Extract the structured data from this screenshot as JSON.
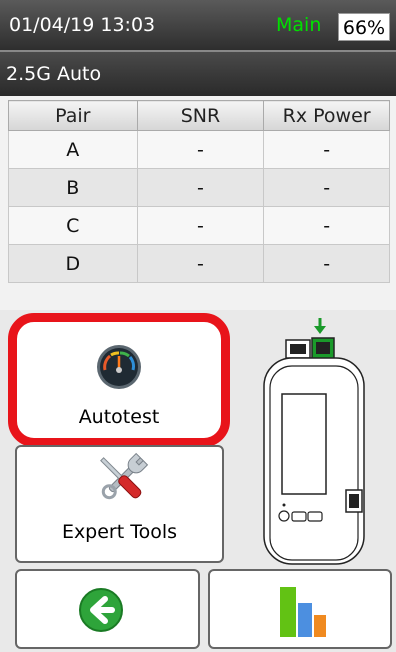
{
  "status_bar": {
    "datetime": "01/04/19 13:03",
    "main_label": "Main",
    "battery": "66%",
    "main_color": "#00e000"
  },
  "link": {
    "speed": "2.5G Auto"
  },
  "table": {
    "headers": [
      "Pair",
      "SNR",
      "Rx Power"
    ],
    "rows": [
      [
        "A",
        "-",
        "-"
      ],
      [
        "B",
        "-",
        "-"
      ],
      [
        "C",
        "-",
        "-"
      ],
      [
        "D",
        "-",
        "-"
      ]
    ]
  },
  "buttons": {
    "autotest": {
      "label": "Autotest",
      "icon": "gauge-icon",
      "highlight_color": "#e8141a"
    },
    "expert_tools": {
      "label": "Expert Tools",
      "icon": "wrench-screwdriver-icon"
    },
    "back": {
      "icon": "back-arrow-icon"
    },
    "results": {
      "icon": "bar-chart-icon"
    }
  },
  "device": {
    "icon": "tester-device-icon",
    "active_port_color": "#1a9a2a"
  }
}
